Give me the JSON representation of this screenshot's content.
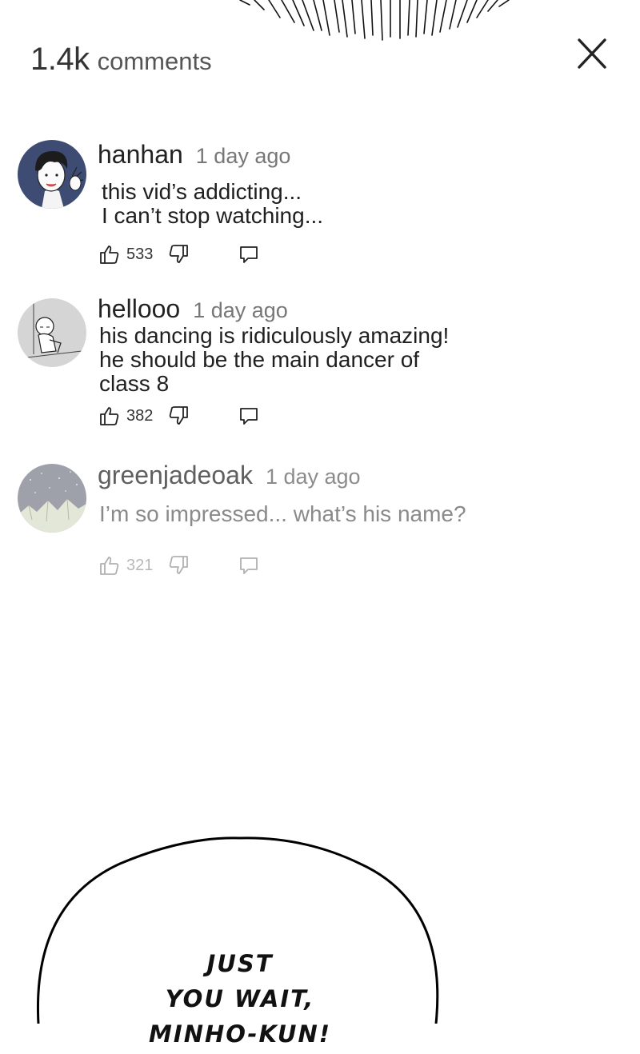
{
  "header": {
    "count": "1.4k",
    "label": "comments"
  },
  "comments": [
    {
      "username": "hanhan",
      "time": "1 day ago",
      "lines": [
        "this vid’s addicting...",
        "I can’t stop watching..."
      ],
      "likes": "533",
      "avatar": "boy-waving-avatar"
    },
    {
      "username": "hellooo",
      "time": "1 day ago",
      "lines": [
        "his dancing is ridiculously amazing!",
        "he should be the main dancer of",
        "class 8"
      ],
      "likes": "382",
      "avatar": "sitting-figure-avatar"
    },
    {
      "username": "greenjadeoak",
      "time": "1 day ago",
      "lines": [
        "I’m so impressed... what’s his name?"
      ],
      "likes": "321",
      "avatar": "night-mountain-avatar"
    }
  ],
  "speech_bubble": {
    "lines": [
      "JUST",
      "YOU WAIT,",
      "MINHO-KUN!"
    ]
  },
  "icons": {
    "close": "close-icon",
    "like": "thumbs-up-icon",
    "dislike": "thumbs-down-icon",
    "reply": "reply-bubble-icon"
  },
  "colors": {
    "background": "#ffffff",
    "text": "#1a1a1a",
    "muted": "#777777",
    "avatar_blue": "#3e4c74"
  }
}
